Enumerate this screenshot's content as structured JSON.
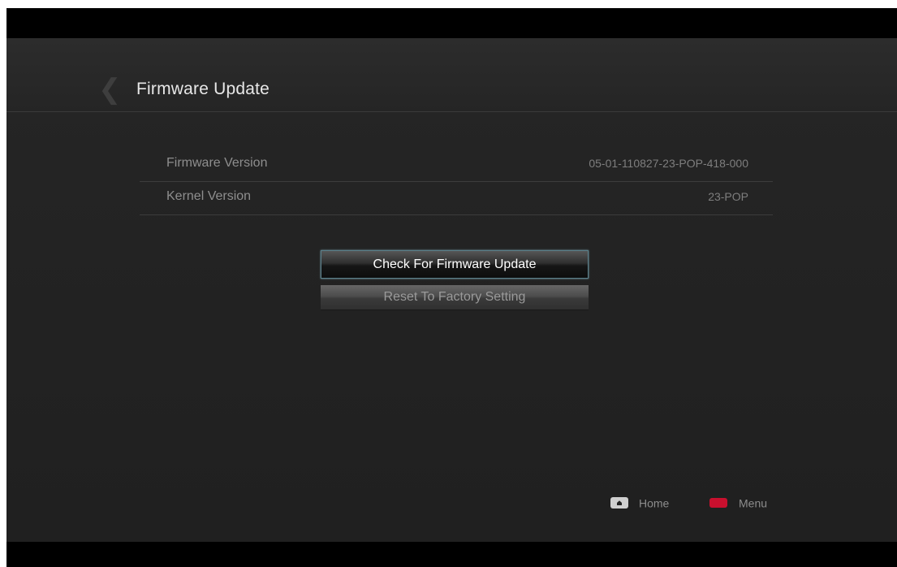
{
  "header": {
    "title": "Firmware Update"
  },
  "info": [
    {
      "label": "Firmware Version",
      "value": "05-01-110827-23-POP-418-000"
    },
    {
      "label": "Kernel Version",
      "value": "23-POP"
    }
  ],
  "actions": {
    "check_label": "Check For Firmware Update",
    "reset_label": "Reset To Factory Setting"
  },
  "footer": {
    "home_label": "Home",
    "menu_label": "Menu"
  },
  "colors": {
    "menu_key": "#c8102e",
    "focus_border": "#5b7f8a"
  },
  "icons": {
    "back": "back-arrow-icon",
    "home": "home-key-icon",
    "menu": "red-key-icon"
  }
}
